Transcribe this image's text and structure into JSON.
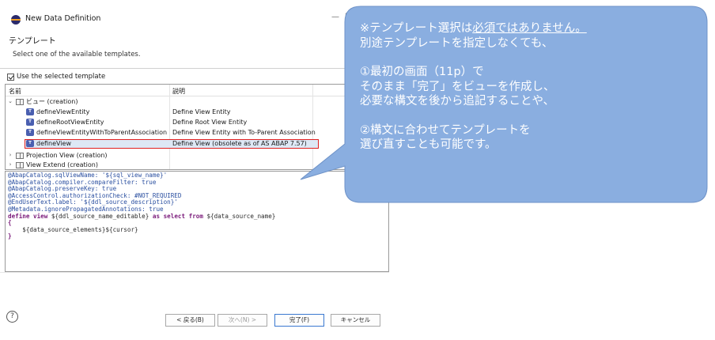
{
  "window": {
    "title": "New Data Definition",
    "minimize_glyph": "—",
    "maximize_glyph": "☐"
  },
  "header": {
    "title": "テンプレート",
    "description": "Select one of the available templates."
  },
  "use_template": {
    "label": "Use the selected template",
    "checked": true
  },
  "table": {
    "columns": [
      "名前",
      "説明"
    ],
    "rows": [
      {
        "name": "ビュー (creation)",
        "desc": "",
        "type": "folder",
        "expanded": true
      },
      {
        "name": "defineViewEntity",
        "desc": "Define View Entity",
        "type": "template"
      },
      {
        "name": "defineRootViewEntity",
        "desc": "Define Root View Entity",
        "type": "template"
      },
      {
        "name": "defineViewEntityWithToParentAssociation",
        "desc": "Define View Entity with To-Parent Association",
        "type": "template"
      },
      {
        "name": "defineView",
        "desc": "Define View (obsolete as of AS ABAP 7.57)",
        "type": "template",
        "selected": true
      },
      {
        "name": "Projection View (creation)",
        "desc": "",
        "type": "folder",
        "expanded": false
      },
      {
        "name": "View Extend (creation)",
        "desc": "",
        "type": "folder",
        "expanded": false
      }
    ]
  },
  "code": {
    "lines": [
      "@AbapCatalog.sqlViewName: '${sql_view_name}'",
      "@AbapCatalog.compiler.compareFilter: true",
      "@AbapCatalog.preserveKey: true",
      "@AccessControl.authorizationCheck: #NOT_REQUIRED",
      "@EndUserText.label: '${ddl_source_description}'",
      "@Metadata.ignorePropagatedAnnotations: true"
    ],
    "define_kw1": "define view ",
    "define_ph1": "${ddl_source_name_editable}",
    "define_kw2": " as select from ",
    "define_ph2": "${data_source_name}",
    "open_brace": "{",
    "elements_line": "    ${data_source_elements}${cursor}",
    "close_brace": "}"
  },
  "buttons": {
    "help": "?",
    "back": "< 戻る(B)",
    "next": "次へ(N) >",
    "finish": "完了(F)",
    "cancel": "キャンセル"
  },
  "callout": {
    "line1a": "※テンプレート選択は",
    "line1b": "必須ではありません。",
    "line2": "別途テンプレートを指定しなくても、",
    "line3": "①最初の画面（11p）で",
    "line4": "そのまま「完了」をビューを作成し、",
    "line5": "必要な構文を後から追記することや、",
    "line6": "②構文に合わせてテンプレートを",
    "line7": "選び直すことも可能です。",
    "color": "#8aaee0"
  }
}
